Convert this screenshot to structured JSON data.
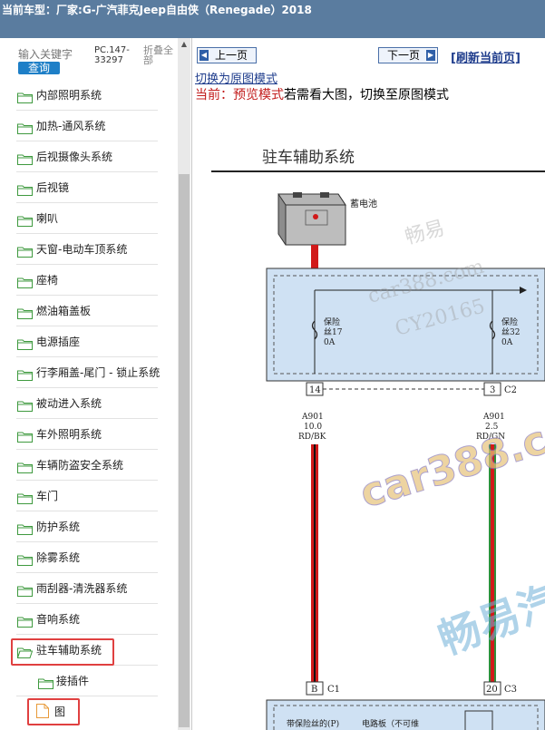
{
  "topbar": {
    "label": "当前车型：",
    "car": "厂家:G-广汽菲克Jeep自由侠（Renegade）2018"
  },
  "sidebar": {
    "search_placeholder": "输入关键字",
    "search_button": "查询",
    "pc_code": "PC.147-33297",
    "collapse_label": "折叠全部",
    "items": [
      {
        "label": "内部照明系统"
      },
      {
        "label": "加热-通风系统"
      },
      {
        "label": "后视摄像头系统"
      },
      {
        "label": "后视镜"
      },
      {
        "label": "喇叭"
      },
      {
        "label": "天窗-电动车顶系统"
      },
      {
        "label": "座椅"
      },
      {
        "label": "燃油箱盖板"
      },
      {
        "label": "电源插座"
      },
      {
        "label": "行李厢盖-尾门 - 锁止系统"
      },
      {
        "label": "被动进入系统"
      },
      {
        "label": "车外照明系统"
      },
      {
        "label": "车辆防盗安全系统"
      },
      {
        "label": "车门"
      },
      {
        "label": "防护系统"
      },
      {
        "label": "除雾系统"
      },
      {
        "label": "雨刮器-清洗器系统"
      },
      {
        "label": "音响系统"
      },
      {
        "label": "驻车辅助系统"
      }
    ],
    "children": [
      {
        "label": "接插件"
      },
      {
        "label": "图"
      }
    ]
  },
  "content": {
    "prev_button": "上一页",
    "next_button": "下一页",
    "refresh_link": "[刷新当前页]",
    "switch_link": "切换为原图模式",
    "mode_prefix": "当前：",
    "mode_value": "预览模式",
    "mode_suffix": "若需看大图，切换至原图模式"
  },
  "diagram": {
    "title": "驻车辅助系统",
    "battery_label": "蓄电池",
    "fuse1_label": "保险",
    "fuse1_label2": "丝17",
    "fuse1_amp": "0A",
    "fuse2_label": "保险",
    "fuse2_label2": "丝32",
    "fuse2_amp": "0A",
    "pin_left": "14",
    "pin_right": "3",
    "conn_right": "C2",
    "wire_left_id": "A901",
    "wire_left_size": "10.0",
    "wire_left_color": "RD/BK",
    "wire_right_id": "A901",
    "wire_right_size": "2.5",
    "wire_right_color": "RD/GN",
    "pin_b": "B",
    "conn_b": "C1",
    "pin_20": "20",
    "conn_20": "C3",
    "bottom_left_text": "带保险丝的(P)",
    "bottom_right_text": "电路板（不可维",
    "watermark_1": "畅易",
    "watermark_2": "car388.com",
    "watermark_3": "CY20165",
    "watermark_4": "car388.co",
    "watermark_5": "畅易汽"
  },
  "colors": {
    "topbar": "#5a7c9f",
    "search_button": "#1e7fc7",
    "highlight": "#e04040",
    "fuse_box": "#cfe1f3",
    "wire_red": "#d11a1a",
    "wire_green": "#2f8f3a"
  }
}
